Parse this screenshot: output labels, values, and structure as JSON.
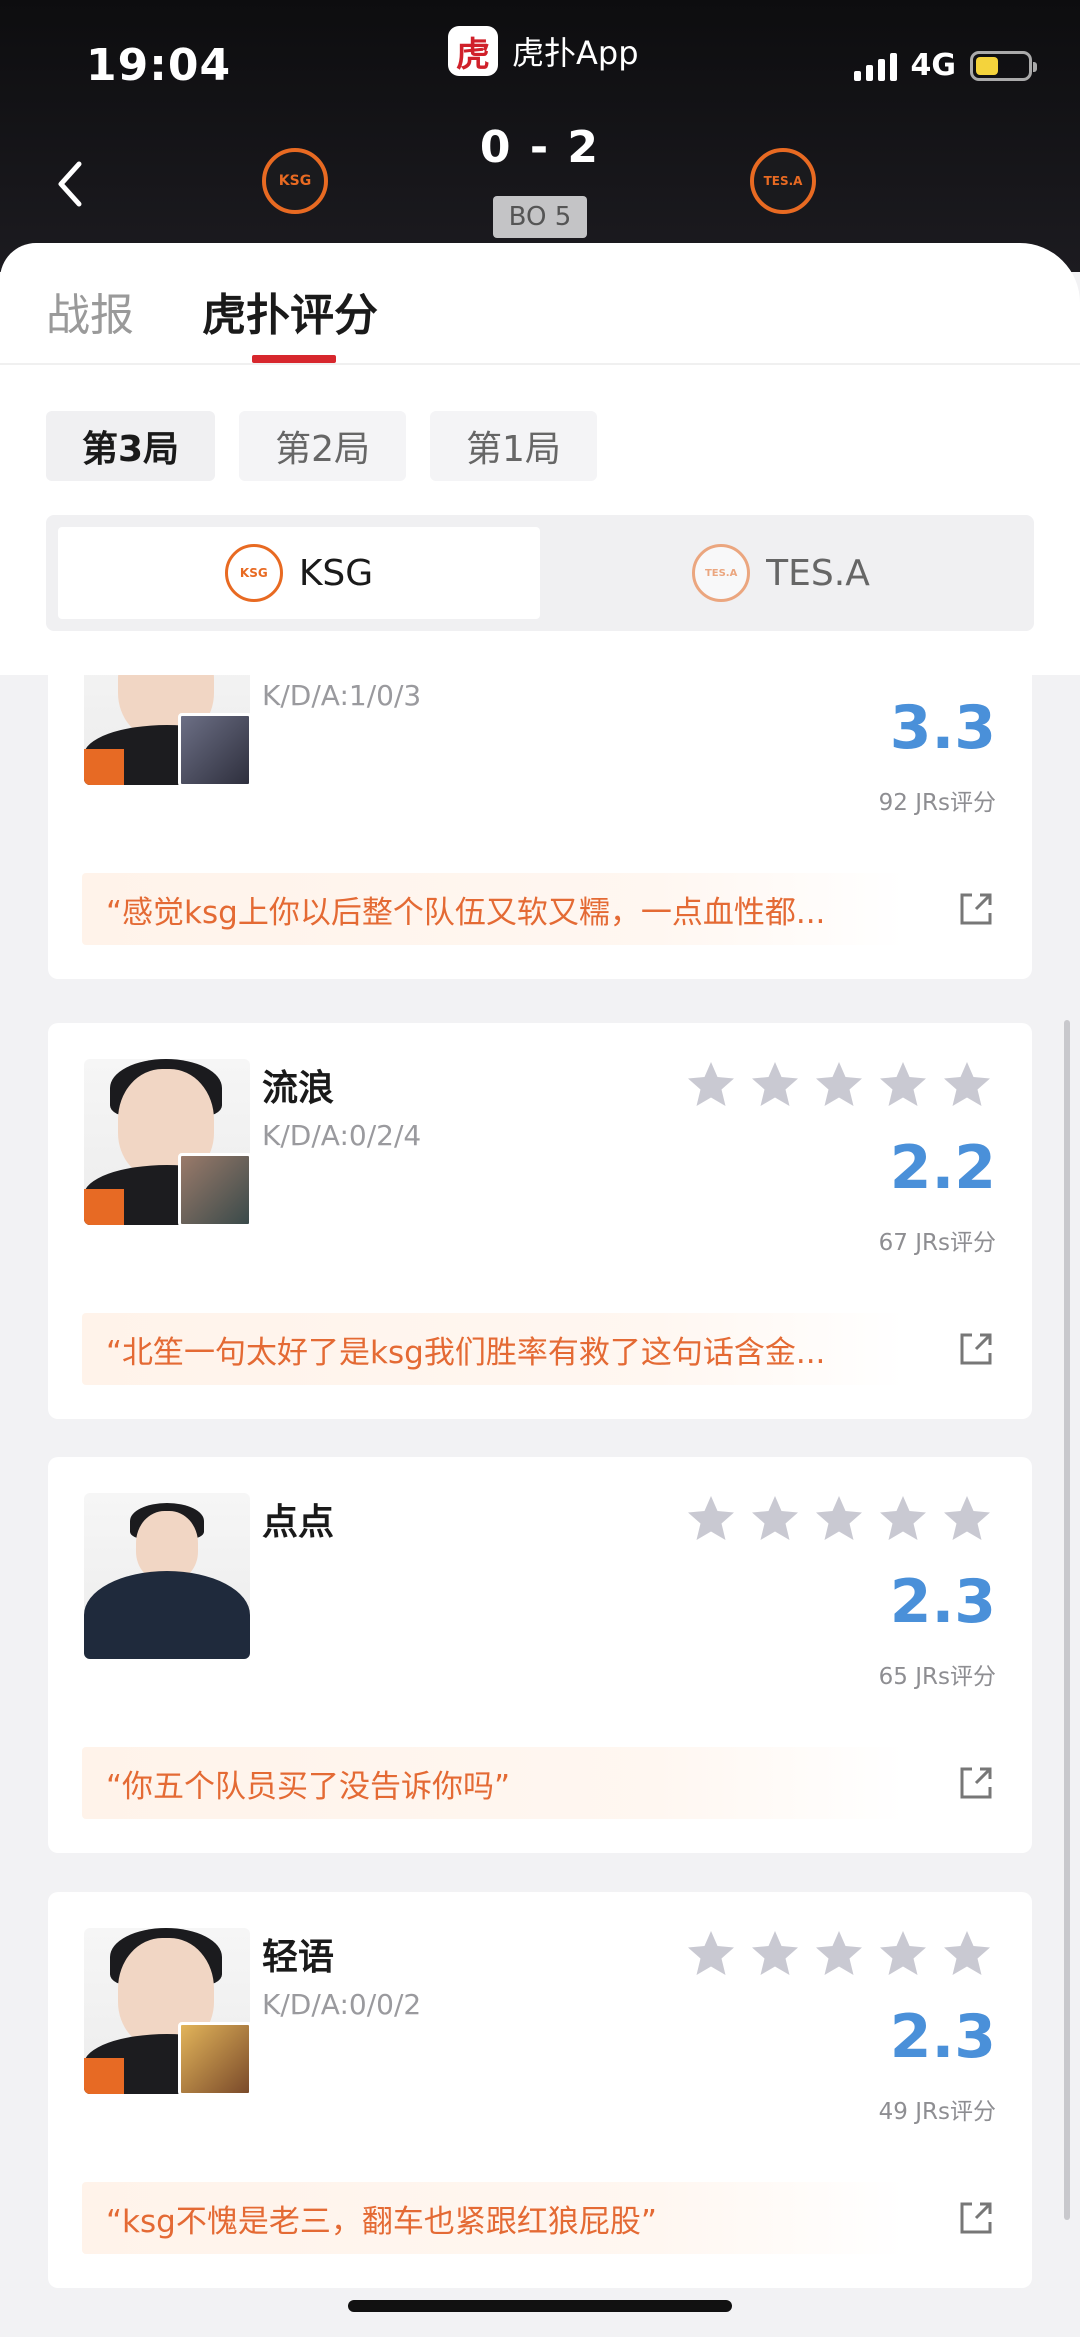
{
  "status_bar": {
    "time": "19:04",
    "app_name": "虎扑App",
    "app_logo_char": "虎",
    "network": "4G",
    "battery_level": 0.44
  },
  "match": {
    "score": "0 - 2",
    "format": "BO 5",
    "home_team_logo_text": "KSG",
    "away_team_logo_text": "TES.A"
  },
  "tabs": [
    {
      "label": "战报",
      "active": false
    },
    {
      "label": "虎扑评分",
      "active": true
    }
  ],
  "rounds": [
    {
      "label": "第3局",
      "active": true
    },
    {
      "label": "第2局",
      "active": false
    },
    {
      "label": "第1局",
      "active": false
    }
  ],
  "team_switch": [
    {
      "name": "KSG",
      "logo_text": "KSG",
      "active": true
    },
    {
      "name": "TES.A",
      "logo_text": "TES.A",
      "active": false
    }
  ],
  "players": [
    {
      "name": "",
      "kda": "K/D/A:1/0/3",
      "rating": "3.3",
      "votes": "92 JRs评分",
      "stars_filled": 0,
      "comment": "“感觉ksg上你以后整个队伍又软又糯，一点血性都..."
    },
    {
      "name": "流浪",
      "kda": "K/D/A:0/2/4",
      "rating": "2.2",
      "votes": "67 JRs评分",
      "stars_filled": 0,
      "comment": "“北笙一句太好了是ksg我们胜率有救了这句话含金..."
    },
    {
      "name": "点点",
      "kda": "",
      "rating": "2.3",
      "votes": "65 JRs评分",
      "stars_filled": 0,
      "comment": "“你五个队员买了没告诉你吗”"
    },
    {
      "name": "轻语",
      "kda": "K/D/A:0/0/2",
      "rating": "2.3",
      "votes": "49 JRs评分",
      "stars_filled": 0,
      "comment": "“ksg不愧是老三，翻车也紧跟红狼屁股”"
    }
  ],
  "colors": {
    "accent_red": "#d7272d",
    "rating_blue": "#4a90d9",
    "comment_orange": "#e46a34",
    "team_orange": "#e86a22",
    "star_gray": "#c9c9d2"
  }
}
